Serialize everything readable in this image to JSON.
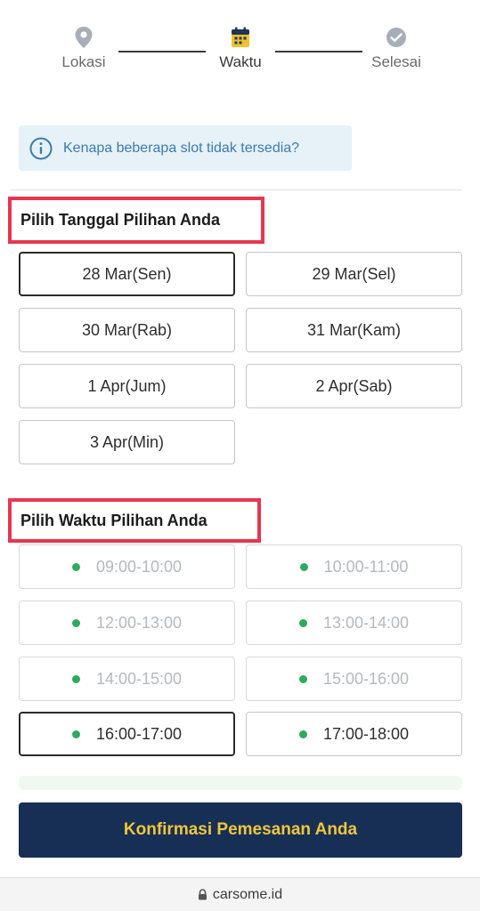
{
  "stepper": {
    "steps": [
      {
        "label": "Lokasi",
        "icon": "location-pin-icon",
        "state": "inactive"
      },
      {
        "label": "Waktu",
        "icon": "calendar-icon",
        "state": "active"
      },
      {
        "label": "Selesai",
        "icon": "check-circle-icon",
        "state": "inactive"
      }
    ]
  },
  "info": {
    "text": "Kenapa beberapa slot tidak tersedia?",
    "icon": "info-icon"
  },
  "date_section": {
    "title": "Pilih Tanggal Pilihan Anda",
    "options": [
      {
        "label": "28 Mar(Sen)",
        "selected": true
      },
      {
        "label": "29 Mar(Sel)",
        "selected": false
      },
      {
        "label": "30 Mar(Rab)",
        "selected": false
      },
      {
        "label": "31 Mar(Kam)",
        "selected": false
      },
      {
        "label": "1 Apr(Jum)",
        "selected": false
      },
      {
        "label": "2 Apr(Sab)",
        "selected": false
      },
      {
        "label": "3 Apr(Min)",
        "selected": false
      }
    ]
  },
  "time_section": {
    "title": "Pilih Waktu Pilihan Anda",
    "options": [
      {
        "label": "09:00-10:00",
        "available": false,
        "selected": false
      },
      {
        "label": "10:00-11:00",
        "available": false,
        "selected": false
      },
      {
        "label": "12:00-13:00",
        "available": false,
        "selected": false
      },
      {
        "label": "13:00-14:00",
        "available": false,
        "selected": false
      },
      {
        "label": "14:00-15:00",
        "available": false,
        "selected": false
      },
      {
        "label": "15:00-16:00",
        "available": false,
        "selected": false
      },
      {
        "label": "16:00-17:00",
        "available": true,
        "selected": true
      },
      {
        "label": "17:00-18:00",
        "available": true,
        "selected": false
      }
    ]
  },
  "confirm_label": "Konfirmasi Pemesanan Anda",
  "url": "carsome.id",
  "colors": {
    "accent_navy": "#172f55",
    "accent_yellow": "#f1c63b",
    "highlight_red": "#e8364f",
    "dot_green": "#2eaa5f",
    "info_blue": "#3b7bb0"
  }
}
